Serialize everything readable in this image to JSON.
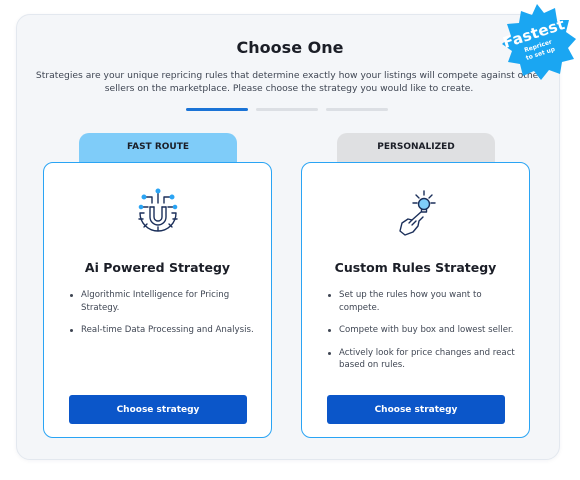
{
  "page": {
    "title": "Choose One",
    "subtitle": "Strategies are your unique repricing rules  that determine exactly how your listings will compete against other sellers on the marketplace. Please choose the strategy you would like to create."
  },
  "steps": {
    "count": 3,
    "current": 1
  },
  "badge": {
    "main": "Fastest",
    "line1": "Repricer",
    "line2": "to set up",
    "color": "#1aa6f2"
  },
  "cards": [
    {
      "tab_label": "FAST ROUTE",
      "icon": "ai-gear-magnet-icon",
      "title": "Ai Powered Strategy",
      "features": [
        "Algorithmic Intelligence for Pricing Strategy.",
        "Real-time Data Processing and Analysis."
      ],
      "button_label": "Choose strategy"
    },
    {
      "tab_label": "PERSONALIZED",
      "icon": "hand-lightbulb-icon",
      "title": "Custom Rules Strategy",
      "features": [
        "Set up the rules how you want to compete.",
        "Compete with buy box and lowest seller.",
        "Actively look for price changes and react based on rules."
      ],
      "button_label": "Choose strategy"
    }
  ],
  "colors": {
    "accent": "#0b56c9",
    "card_border": "#2aa4f4",
    "tab_fast": "#7fccf9",
    "tab_personalized": "#dfe0e2",
    "progress_active": "#1a73d6"
  }
}
